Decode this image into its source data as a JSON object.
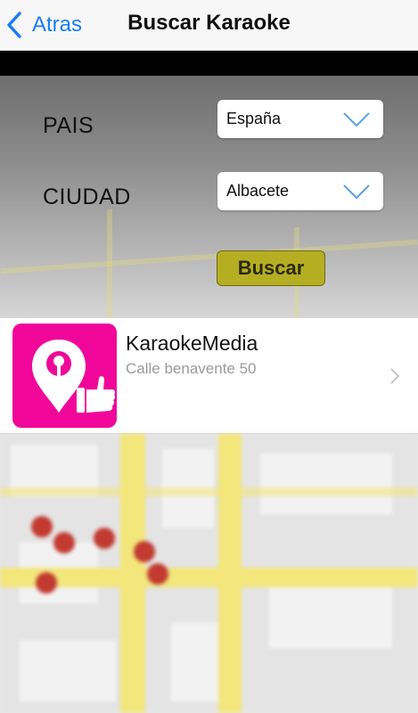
{
  "navbar": {
    "back_label": "Atras",
    "title": "Buscar Karaoke"
  },
  "form": {
    "country_label": "PAIS",
    "country_value": "España",
    "city_label": "CIUDAD",
    "city_value": "Albacete",
    "search_button": "Buscar"
  },
  "results": [
    {
      "name": "KaraokeMedia",
      "address": "Calle benavente 50"
    }
  ],
  "colors": {
    "accent": "#1a7cf5",
    "button": "#b6ae22",
    "thumbnail": "#f0079a"
  },
  "icons": {
    "back": "chevron-left-icon",
    "dropdown": "chevron-down-icon",
    "row": "chevron-right-icon",
    "logo": "karaoke-pin-thumbs-up-icon"
  }
}
